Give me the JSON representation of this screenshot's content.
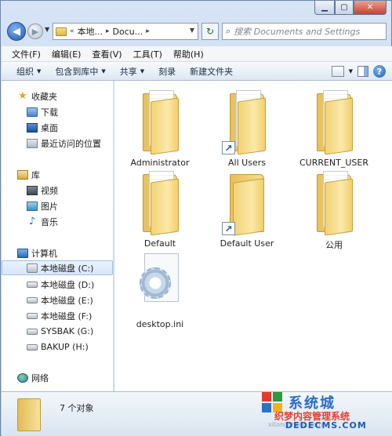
{
  "window_controls": {
    "minimize": "▁",
    "maximize": "▢",
    "close": "✕"
  },
  "nav": {
    "back": "◀",
    "forward": "▶",
    "dropdown": "▼"
  },
  "address": {
    "crumb_prefix": "«",
    "crumbs": [
      "本地...",
      "Docu..."
    ],
    "separator": "▸",
    "dropdown": "▼",
    "refresh": "↻"
  },
  "search": {
    "placeholder": "搜索 Documents and Settings",
    "icon": "⌕"
  },
  "menubar": [
    "文件(F)",
    "编辑(E)",
    "查看(V)",
    "工具(T)",
    "帮助(H)"
  ],
  "cmdbar": {
    "organize": "组织",
    "include_library": "包含到库中",
    "share": "共享",
    "burn": "刻录",
    "new_folder": "新建文件夹",
    "caret": "▼",
    "help": "?"
  },
  "nav_pane": {
    "favorites": {
      "label": "收藏夹",
      "items": [
        "下载",
        "桌面",
        "最近访问的位置"
      ]
    },
    "libraries": {
      "label": "库",
      "items": [
        "视频",
        "图片",
        "音乐"
      ]
    },
    "computer": {
      "label": "计算机",
      "drives": [
        "本地磁盘 (C:)",
        "本地磁盘 (D:)",
        "本地磁盘 (E:)",
        "本地磁盘 (F:)",
        "SYSBAK (G:)",
        "BAKUP (H:)"
      ]
    },
    "network": {
      "label": "网络"
    },
    "icons": {
      "star": "★",
      "music": "♪"
    }
  },
  "items": [
    {
      "name": "Administrator",
      "type": "folder",
      "shortcut": false
    },
    {
      "name": "All Users",
      "type": "folder",
      "shortcut": true
    },
    {
      "name": "CURRENT_USER",
      "type": "folder",
      "shortcut": false
    },
    {
      "name": "Default",
      "type": "folder",
      "shortcut": false
    },
    {
      "name": "Default User",
      "type": "folder",
      "shortcut": true
    },
    {
      "name": "公用",
      "type": "folder",
      "shortcut": false
    },
    {
      "name": "desktop.ini",
      "type": "ini",
      "shortcut": false
    }
  ],
  "shortcut_glyph": "↗",
  "details": {
    "count": "7 个对象"
  },
  "watermark": {
    "title": "系统城",
    "line1": "织梦内容管理系统",
    "line2": "DEDECMS.COM",
    "line3": "xitongcheng.com"
  }
}
